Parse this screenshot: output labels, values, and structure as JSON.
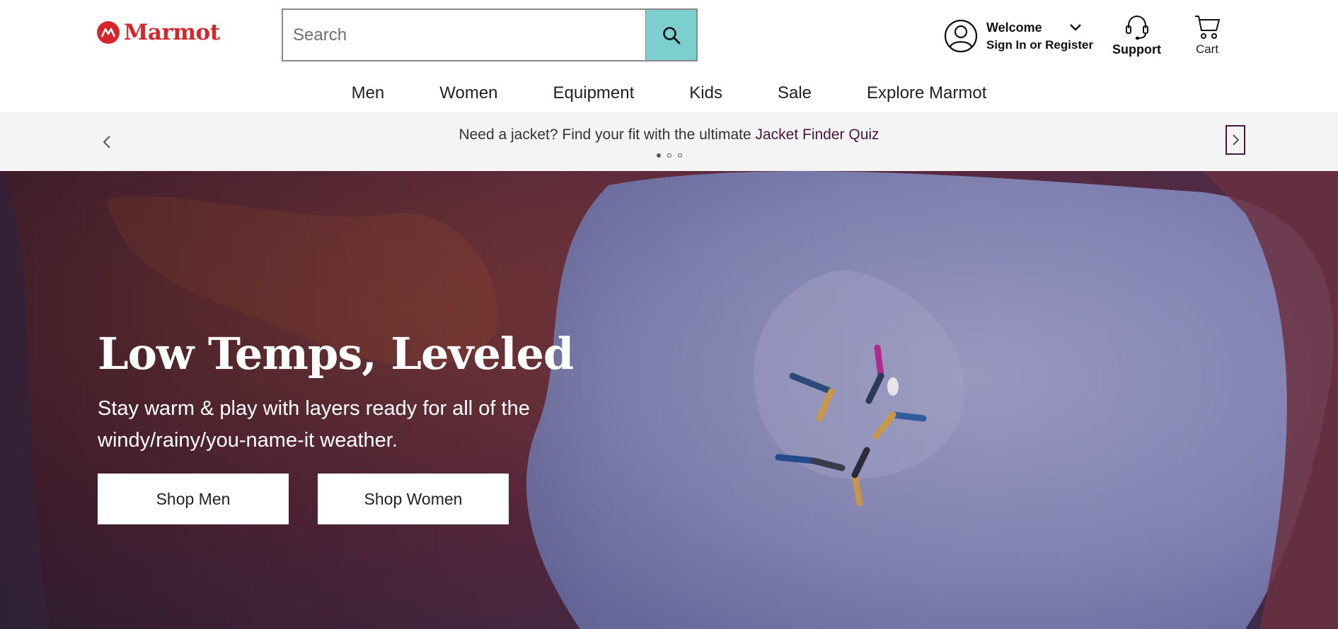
{
  "brand": {
    "name": "Marmot",
    "color": "#d5262b"
  },
  "search": {
    "placeholder": "Search",
    "value": "",
    "button_icon": "search-icon",
    "button_color": "#7ccfcf"
  },
  "account": {
    "welcome": "Welcome",
    "signin": "Sign In or Register",
    "icon": "user-icon"
  },
  "support": {
    "label": "Support",
    "icon": "headset-icon"
  },
  "cart": {
    "label": "Cart",
    "icon": "cart-icon"
  },
  "nav": {
    "items": [
      "Men",
      "Women",
      "Equipment",
      "Kids",
      "Sale",
      "Explore Marmot"
    ]
  },
  "promo": {
    "text": "Need a jacket? Find your fit with the ultimate ",
    "link": "Jacket Finder Quiz",
    "link_color": "#4a1541",
    "dots": 3,
    "active_dot": 0
  },
  "hero": {
    "title": "Low Temps, Leveled",
    "subtitle": "Stay warm & play with layers ready for all of the windy/rainy/you-name-it weather.",
    "buttons": [
      "Shop Men",
      "Shop Women"
    ]
  }
}
